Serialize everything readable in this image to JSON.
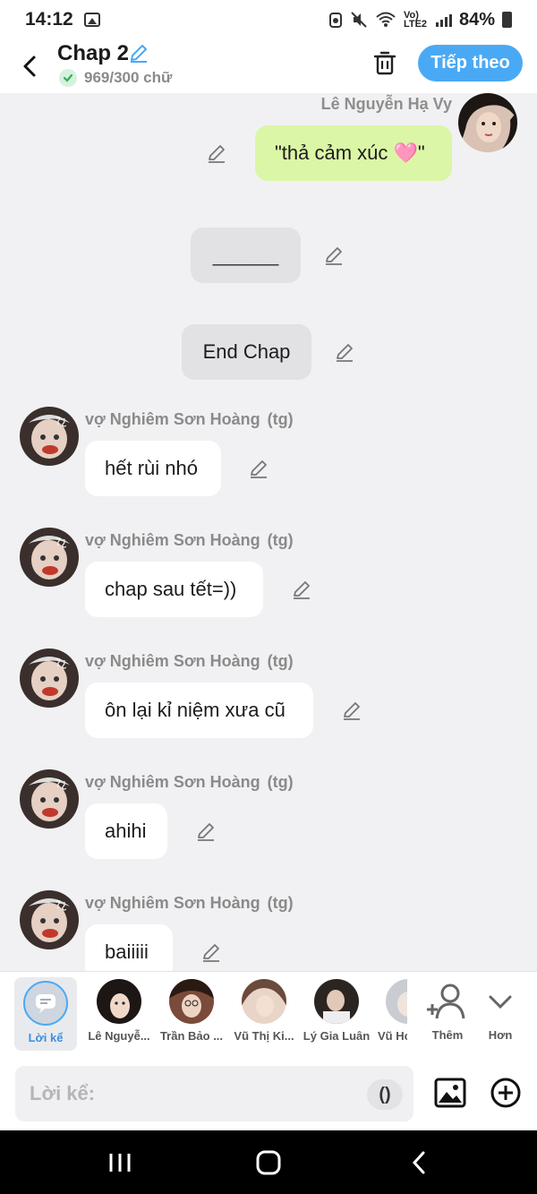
{
  "status": {
    "time": "14:12",
    "network": "Vo) LTE2",
    "battery": "84%"
  },
  "header": {
    "title": "Chap 2",
    "word_count": "969/300 chữ",
    "next_label": "Tiếp theo"
  },
  "messages": {
    "m1": {
      "author": "Lê Nguyễn Hạ Vy",
      "text": "\"thả cảm xúc 🩷\""
    },
    "m2": {
      "text": "______"
    },
    "m3": {
      "text": "End Chap"
    },
    "author_left": "vợ Nghiêm Sơn Hoàng",
    "tag": "(tg)",
    "m4": {
      "text": "hết rùi nhó"
    },
    "m5": {
      "text": "chap sau tết=))"
    },
    "m6": {
      "text": "ôn lại kỉ niệm xưa cũ"
    },
    "m7": {
      "text": "ahihi"
    },
    "m8": {
      "text": "baiiiii"
    }
  },
  "characters": [
    {
      "label": "Lời kể"
    },
    {
      "label": "Lê Nguyễ..."
    },
    {
      "label": "Trần Bảo ..."
    },
    {
      "label": "Vũ Thị Ki..."
    },
    {
      "label": "Lý Gia Luân"
    },
    {
      "label": "Vũ Ho"
    },
    {
      "label": "Thêm"
    },
    {
      "label": "Hơn"
    }
  ],
  "input": {
    "placeholder": "Lời kể:",
    "paren": "()"
  },
  "colors": {
    "accent": "#4aa9f5",
    "my_bubble": "#dbf6a6",
    "sys_bubble": "#e2e2e4"
  }
}
